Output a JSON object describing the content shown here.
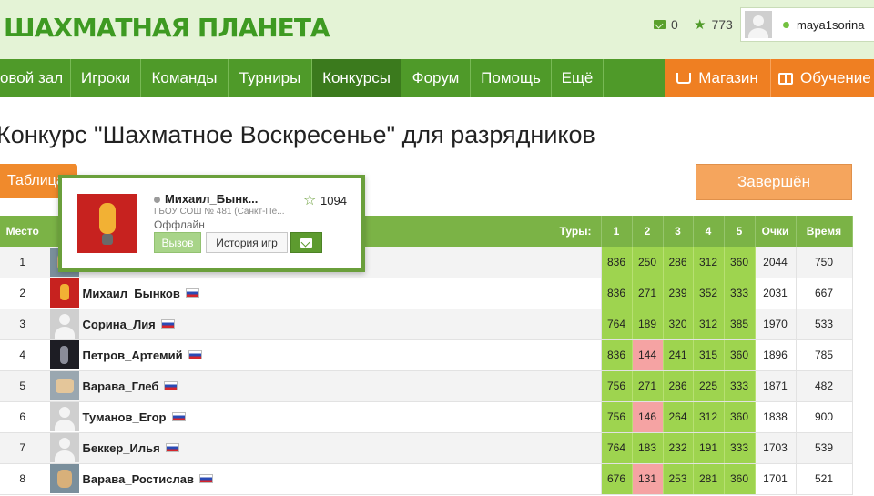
{
  "header": {
    "logo": "ШАХМАТНАЯ ПЛАНЕТА",
    "messages_count": "0",
    "rating": "773",
    "username": "maya1sorina"
  },
  "nav": {
    "items": [
      "овой зал",
      "Игроки",
      "Команды",
      "Турниры",
      "Конкурсы",
      "Форум",
      "Помощь",
      "Ещё"
    ],
    "shop": "Магазин",
    "learning": "Обучение"
  },
  "page": {
    "title": "Конкурс \"Шахматное Воскресенье\" для разрядников",
    "table_button": "Таблица",
    "finished_button": "Завершён"
  },
  "table": {
    "headers": {
      "place": "Место",
      "rounds": "Туры:",
      "r1": "1",
      "r2": "2",
      "r3": "3",
      "r4": "4",
      "r5": "5",
      "points": "Очки",
      "time": "Время"
    },
    "rows": [
      {
        "place": "1",
        "name": "",
        "r": [
          "836",
          "250",
          "286",
          "312",
          "360"
        ],
        "points": "2044",
        "time": "750"
      },
      {
        "place": "2",
        "name": "Михаил_Бынков",
        "r": [
          "836",
          "271",
          "239",
          "352",
          "333"
        ],
        "points": "2031",
        "time": "667"
      },
      {
        "place": "3",
        "name": "Сорина_Лия",
        "r": [
          "764",
          "189",
          "320",
          "312",
          "385"
        ],
        "points": "1970",
        "time": "533"
      },
      {
        "place": "4",
        "name": "Петров_Артемий",
        "r": [
          "836",
          "144",
          "241",
          "315",
          "360"
        ],
        "points": "1896",
        "time": "785"
      },
      {
        "place": "5",
        "name": "Варава_Глеб",
        "r": [
          "756",
          "271",
          "286",
          "225",
          "333"
        ],
        "points": "1871",
        "time": "482"
      },
      {
        "place": "6",
        "name": "Туманов_Егор",
        "r": [
          "756",
          "146",
          "264",
          "312",
          "360"
        ],
        "points": "1838",
        "time": "900"
      },
      {
        "place": "7",
        "name": "Беккер_Илья",
        "r": [
          "764",
          "183",
          "232",
          "191",
          "333"
        ],
        "points": "1703",
        "time": "539"
      },
      {
        "place": "8",
        "name": "Варава_Ростислав",
        "r": [
          "676",
          "131",
          "253",
          "281",
          "360"
        ],
        "points": "1701",
        "time": "521"
      }
    ]
  },
  "popup": {
    "name": "Михаил_Бынк...",
    "school": "ГБОУ СОШ № 481 (Санкт-Пе...",
    "status": "Оффлайн",
    "rating": "1094",
    "challenge": "Вызов",
    "history": "История игр"
  },
  "colors": {
    "brand_green": "#4f9a29",
    "header_bg": "#e4f3d6",
    "accent_orange": "#ef7f22",
    "cell_green": "#9ed44f",
    "cell_red": "#f5a3a3"
  },
  "icons": [
    "mail-icon",
    "star-icon",
    "cart-icon",
    "book-icon",
    "online-dot",
    "flag-ru-icon"
  ]
}
